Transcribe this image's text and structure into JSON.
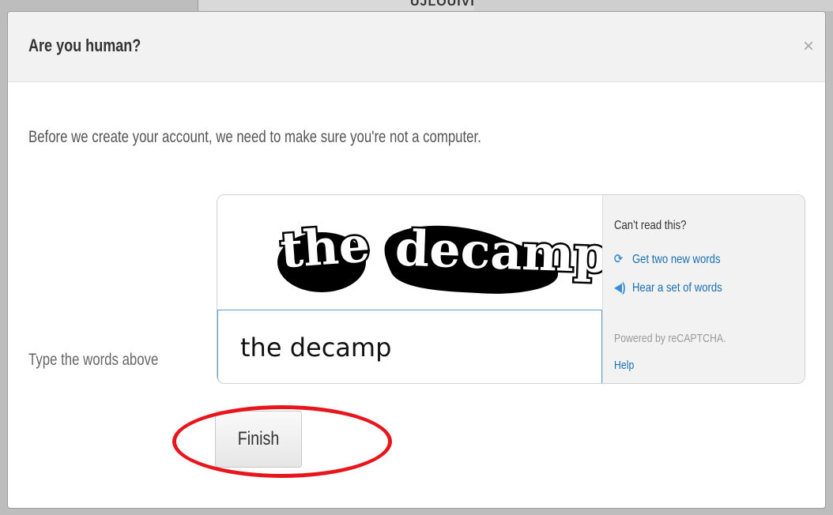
{
  "background": {
    "partial_text": "UJLOUIVIIYA I U"
  },
  "dialog": {
    "title": "Are you human?",
    "close_glyph": "×",
    "intro": "Before we create your account, we need to make sure you're not a computer.",
    "input_label": "Type the words above",
    "finish_label": "Finish"
  },
  "captcha": {
    "image_words": [
      "the",
      "decamp"
    ],
    "input_value": "the decamp",
    "heading": "Can't read this?",
    "new_words_label": "Get two new words",
    "new_words_icon": "refresh-icon",
    "audio_label": "Hear a set of words",
    "audio_icon": "speaker-icon",
    "powered_by": "Powered by reCAPTCHA.",
    "help_label": "Help"
  },
  "colors": {
    "link": "#1a6fb0",
    "input_border": "#5a9fd4",
    "highlight": "#e8161c",
    "header_bg": "#f2f2f2"
  }
}
